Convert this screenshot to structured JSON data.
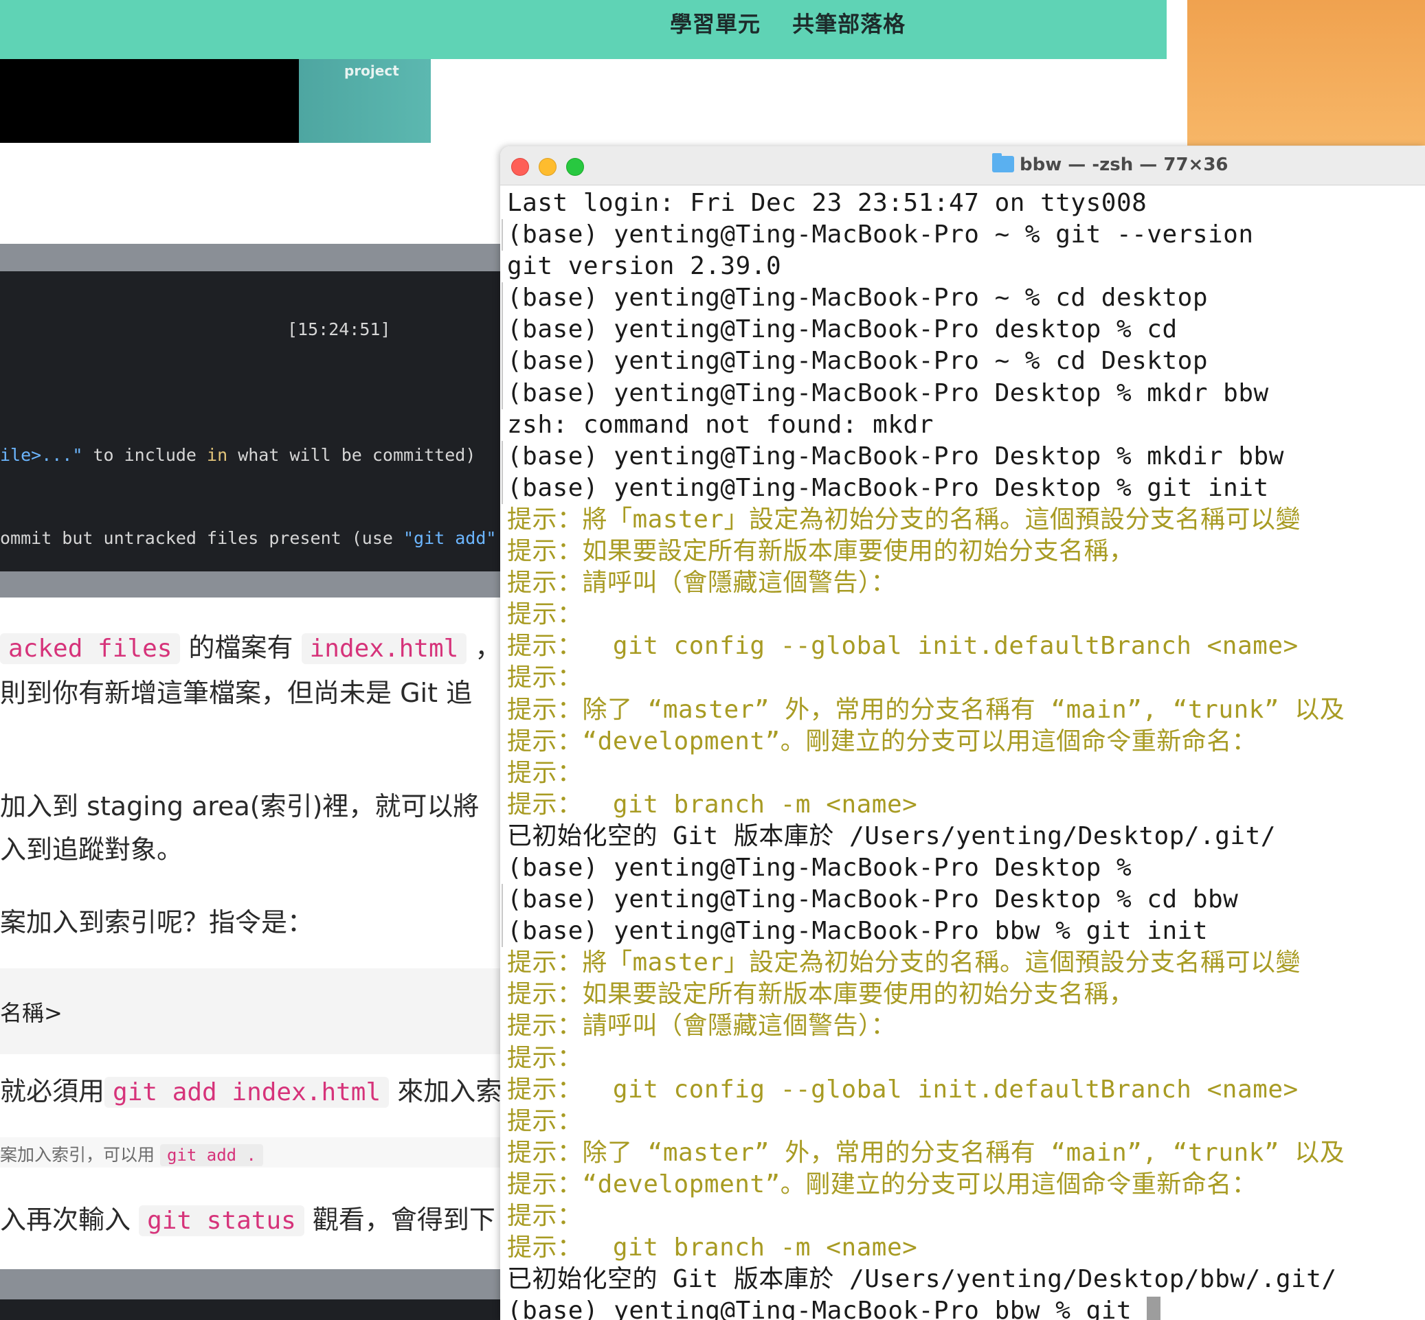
{
  "background_page": {
    "nav": [
      "學習單元",
      "共筆部落格"
    ],
    "image_label": "project",
    "screenshot": {
      "time": "[15:24:51]",
      "line1_a": "ile>...\"",
      "line1_b": " to include ",
      "line1_c": "in",
      "line1_d": " what will be committed)",
      "line2_a": "ommit but untracked files present (use ",
      "line2_b": "\"git add\""
    },
    "p1_code1": "acked files",
    "p1_text1": " 的檔案有 ",
    "p1_code2": "index.html",
    "p1_text2": " ，",
    "p2": "則到你有新增這筆檔案，但尚未是 Git 追",
    "p3": "加入到 staging area(索引)裡，就可以將",
    "p4": "入到追蹤對象。",
    "p5": "案加入到索引呢？指令是：",
    "codeblock": "名稱>",
    "p6_text1": "就必須用",
    "p6_code": "git add index.html",
    "p6_text2": " 來加入索",
    "note_text": "案加入索引，可以用 ",
    "note_code": "git add .",
    "p7_text1": "入再次輸入 ",
    "p7_code": "git status",
    "p7_text2": " 觀看，會得到下"
  },
  "terminal": {
    "title": "bbw — -zsh — 77×36",
    "lines": [
      {
        "text": "Last login: Fri Dec 23 23:51:47 on ttys008",
        "type": "out"
      },
      {
        "text": "(base) yenting@Ting-MacBook-Pro ~ % git --version",
        "type": "cmd"
      },
      {
        "text": "git version 2.39.0",
        "type": "out"
      },
      {
        "text": "(base) yenting@Ting-MacBook-Pro ~ % cd desktop",
        "type": "cmd"
      },
      {
        "text": "(base) yenting@Ting-MacBook-Pro desktop % cd",
        "type": "cmd"
      },
      {
        "text": "(base) yenting@Ting-MacBook-Pro ~ % cd Desktop",
        "type": "cmd"
      },
      {
        "text": "(base) yenting@Ting-MacBook-Pro Desktop % mkdr bbw",
        "type": "cmd"
      },
      {
        "text": "zsh: command not found: mkdr",
        "type": "out"
      },
      {
        "text": "(base) yenting@Ting-MacBook-Pro Desktop % mkdir bbw",
        "type": "cmd"
      },
      {
        "text": "(base) yenting@Ting-MacBook-Pro Desktop % git init",
        "type": "cmd"
      },
      {
        "text": "提示：將「master」設定為初始分支的名稱。這個預設分支名稱可以變",
        "type": "hint"
      },
      {
        "text": "提示：如果要設定所有新版本庫要使用的初始分支名稱，",
        "type": "hint"
      },
      {
        "text": "提示：請呼叫（會隱藏這個警告）：",
        "type": "hint"
      },
      {
        "text": "提示：",
        "type": "hint"
      },
      {
        "text": "提示：  git config --global init.defaultBranch <name>",
        "type": "hint"
      },
      {
        "text": "提示：",
        "type": "hint"
      },
      {
        "text": "提示：除了 “master” 外，常用的分支名稱有 “main”, “trunk” 以及",
        "type": "hint"
      },
      {
        "text": "提示：“development”。剛建立的分支可以用這個命令重新命名：",
        "type": "hint"
      },
      {
        "text": "提示：",
        "type": "hint"
      },
      {
        "text": "提示：  git branch -m <name>",
        "type": "hint"
      },
      {
        "text": "已初始化空的 Git 版本庫於 /Users/yenting/Desktop/.git/",
        "type": "out"
      },
      {
        "text": "(base) yenting@Ting-MacBook-Pro Desktop %",
        "type": "out"
      },
      {
        "text": "(base) yenting@Ting-MacBook-Pro Desktop % cd bbw",
        "type": "cmd"
      },
      {
        "text": "(base) yenting@Ting-MacBook-Pro bbw % git init",
        "type": "cmd"
      },
      {
        "text": "提示：將「master」設定為初始分支的名稱。這個預設分支名稱可以變",
        "type": "hint"
      },
      {
        "text": "提示：如果要設定所有新版本庫要使用的初始分支名稱，",
        "type": "hint"
      },
      {
        "text": "提示：請呼叫（會隱藏這個警告）：",
        "type": "hint"
      },
      {
        "text": "提示：",
        "type": "hint"
      },
      {
        "text": "提示：  git config --global init.defaultBranch <name>",
        "type": "hint"
      },
      {
        "text": "提示：",
        "type": "hint"
      },
      {
        "text": "提示：除了 “master” 外，常用的分支名稱有 “main”, “trunk” 以及",
        "type": "hint"
      },
      {
        "text": "提示：“development”。剛建立的分支可以用這個命令重新命名：",
        "type": "hint"
      },
      {
        "text": "提示：",
        "type": "hint"
      },
      {
        "text": "提示：  git branch -m <name>",
        "type": "hint"
      },
      {
        "text": "已初始化空的 Git 版本庫於 /Users/yenting/Desktop/bbw/.git/",
        "type": "out"
      },
      {
        "text": "(base) yenting@Ting-MacBook-Pro bbw % git ",
        "type": "current"
      }
    ]
  },
  "colors": {
    "header_teal": "#5fd3b5",
    "hint_yellow": "#a89b23",
    "inline_code_pink": "#d6337a"
  }
}
